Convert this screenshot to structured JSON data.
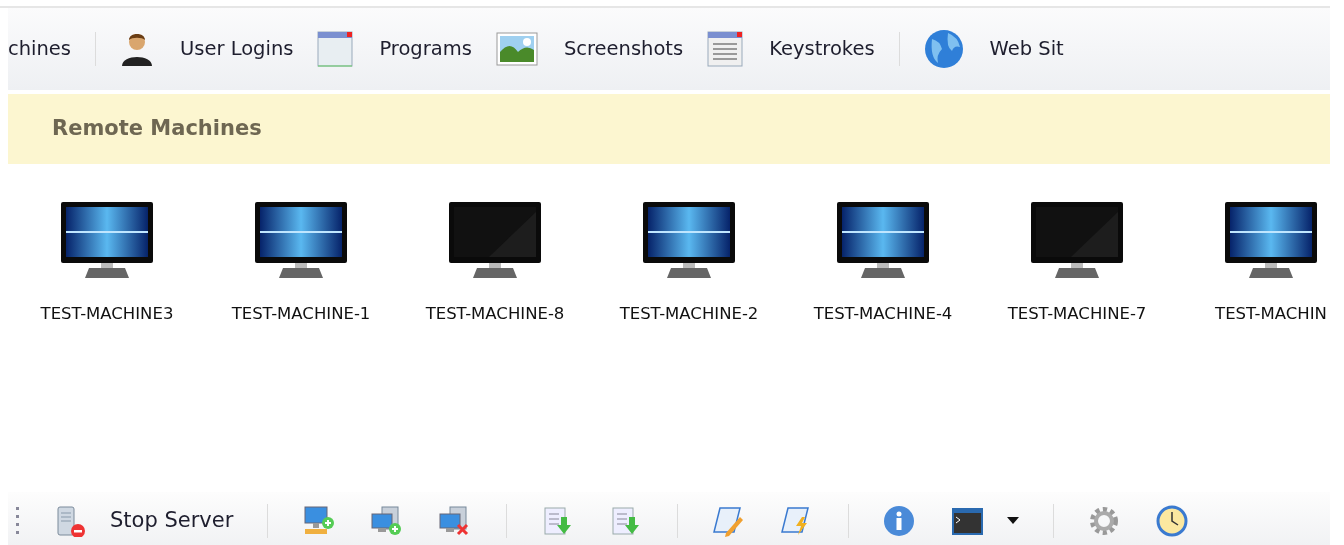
{
  "nav_tabs": [
    {
      "kind": "text",
      "label": "chines"
    },
    {
      "kind": "separator"
    },
    {
      "kind": "user",
      "label": "User Logins"
    },
    {
      "kind": "window",
      "label": "Programs"
    },
    {
      "kind": "picture",
      "label": "Screenshots"
    },
    {
      "kind": "listing",
      "label": "Keystrokes"
    },
    {
      "kind": "separator"
    },
    {
      "kind": "globe",
      "label": "Web Sit"
    }
  ],
  "section_header": {
    "title": "Remote Machines"
  },
  "machines": [
    {
      "name": "TEST-MACHINE3",
      "online": true
    },
    {
      "name": "TEST-MACHINE-1",
      "online": true
    },
    {
      "name": "TEST-MACHINE-8",
      "online": false
    },
    {
      "name": "TEST-MACHINE-2",
      "online": true
    },
    {
      "name": "TEST-MACHINE-4",
      "online": true
    },
    {
      "name": "TEST-MACHINE-7",
      "online": false
    },
    {
      "name": "TEST-MACHIN",
      "online": true
    }
  ],
  "toolbar": [
    {
      "kind": "server",
      "label": "Stop Server"
    },
    {
      "kind": "separator"
    },
    {
      "kind": "addhost"
    },
    {
      "kind": "addgroup"
    },
    {
      "kind": "remove"
    },
    {
      "kind": "separator"
    },
    {
      "kind": "import"
    },
    {
      "kind": "export"
    },
    {
      "kind": "separator"
    },
    {
      "kind": "edit"
    },
    {
      "kind": "script"
    },
    {
      "kind": "separator"
    },
    {
      "kind": "info"
    },
    {
      "kind": "console",
      "dropdown": true
    },
    {
      "kind": "separator"
    },
    {
      "kind": "settings"
    },
    {
      "kind": "clock"
    }
  ]
}
